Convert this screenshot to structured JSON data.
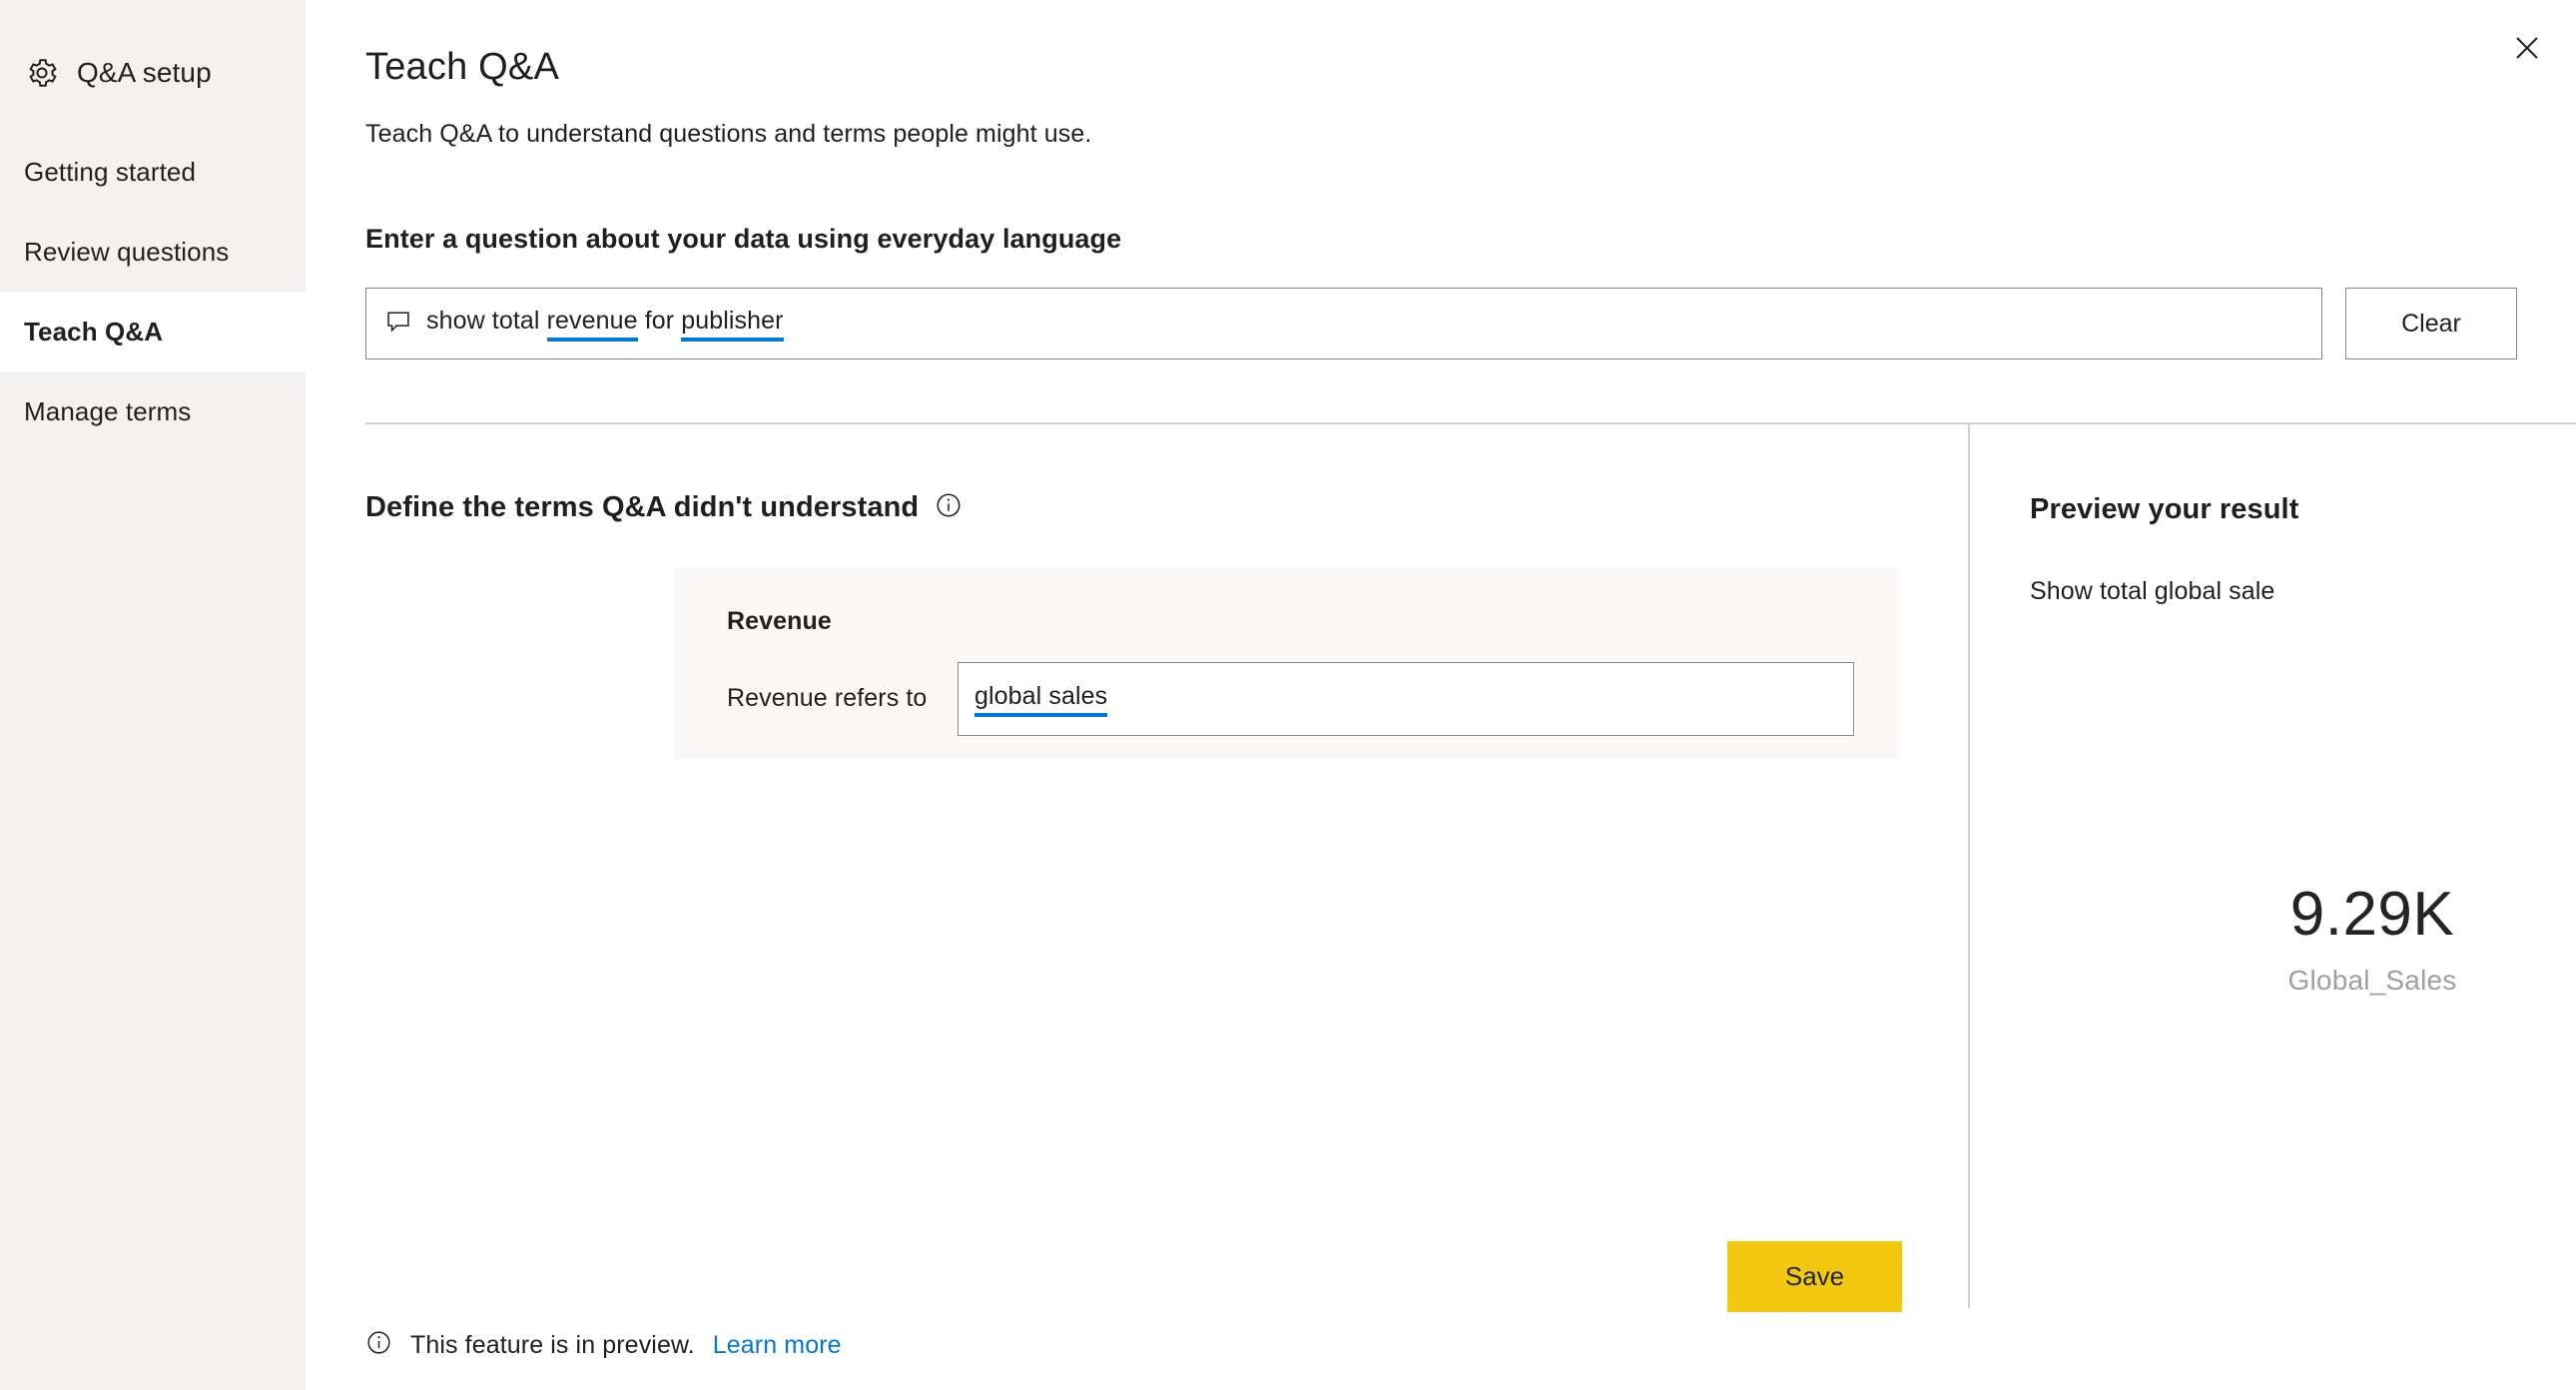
{
  "sidebar": {
    "icon": "gear-icon",
    "title": "Q&A setup",
    "items": [
      {
        "label": "Getting started",
        "selected": false
      },
      {
        "label": "Review questions",
        "selected": false
      },
      {
        "label": "Teach Q&A",
        "selected": true
      },
      {
        "label": "Manage terms",
        "selected": false
      }
    ]
  },
  "header": {
    "title": "Teach Q&A",
    "subtitle": "Teach Q&A to understand questions and terms people might use.",
    "close_icon": "close-icon"
  },
  "question_section": {
    "label": "Enter a question about your data using everyday language",
    "icon": "chat-bubble-icon",
    "placeholder": "Ask a question about your data",
    "parts": [
      {
        "text": "show total ",
        "underlined": false
      },
      {
        "text": "revenue",
        "underlined": true
      },
      {
        "text": " for ",
        "underlined": false
      },
      {
        "text": "publisher",
        "underlined": true
      }
    ],
    "full_value": "show total revenue for publisher",
    "clear_label": "Clear"
  },
  "define_section": {
    "title": "Define the terms Q&A didn't understand",
    "info_icon": "info-icon",
    "terms": [
      {
        "name": "Revenue",
        "refers_label": "Revenue refers to",
        "value": "global sales",
        "placeholder": "Enter a field or term"
      }
    ],
    "save_label": "Save"
  },
  "preview": {
    "title": "Preview your result",
    "question": "Show total global sale",
    "kpi_value": "9.29K",
    "kpi_label": "Global_Sales"
  },
  "footer": {
    "icon": "info-icon",
    "text": "This feature is in preview.",
    "link": "Learn more"
  },
  "colors": {
    "accent": "#0078d4",
    "save_button": "#f2c811",
    "sidebar_bg": "#f3f2f1",
    "card_bg": "#faf9f8",
    "divider": "#d2d0ce",
    "muted_text": "#a19f9d"
  }
}
